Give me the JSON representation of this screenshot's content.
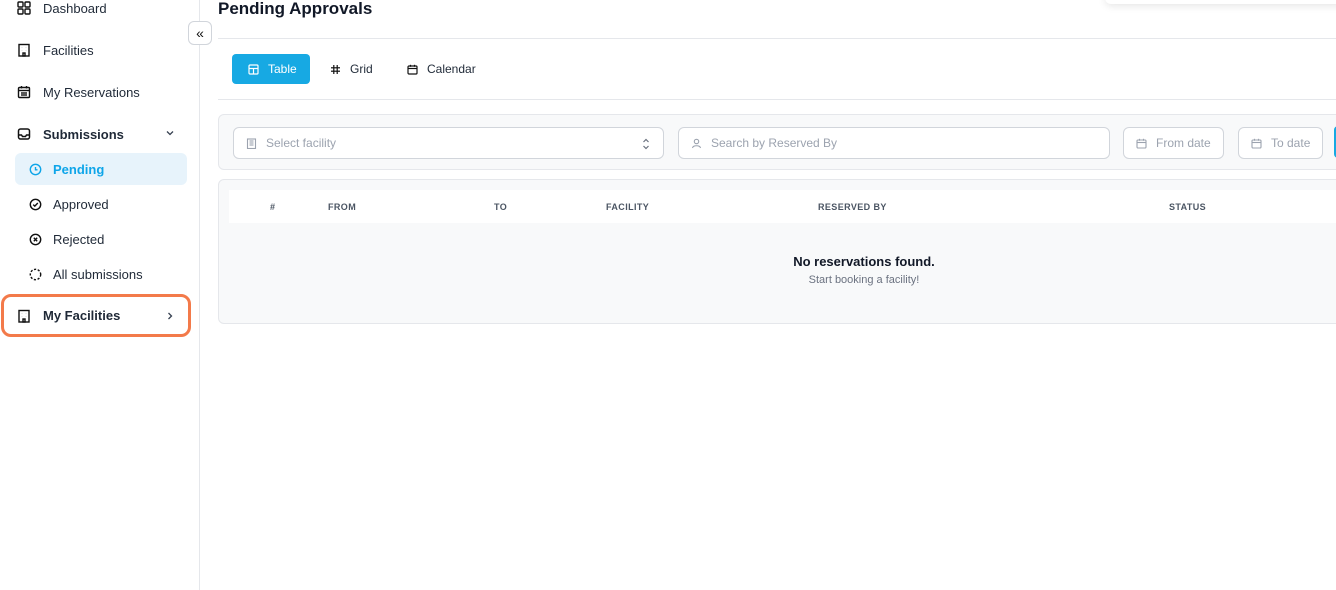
{
  "sidebar": {
    "nav": [
      {
        "label": "Dashboard",
        "icon": "dashboard-icon"
      },
      {
        "label": "Facilities",
        "icon": "building-icon"
      },
      {
        "label": "My Reservations",
        "icon": "calendar-icon"
      },
      {
        "label": "Submissions",
        "icon": "inbox-icon"
      }
    ],
    "submissions_items": [
      {
        "label": "Pending",
        "icon": "clock-icon",
        "active": true
      },
      {
        "label": "Approved",
        "icon": "check-circle-icon"
      },
      {
        "label": "Rejected",
        "icon": "x-circle-icon"
      },
      {
        "label": "All submissions",
        "icon": "dashed-circle-icon"
      }
    ],
    "my_facilities": {
      "label": "My Facilities",
      "icon": "building-icon",
      "highlighted": true
    },
    "collapse_glyph": "«"
  },
  "main": {
    "title": "Pending Approvals",
    "view_tabs": [
      {
        "label": "Table",
        "icon": "table-icon",
        "active": true
      },
      {
        "label": "Grid",
        "icon": "grid-icon"
      },
      {
        "label": "Calendar",
        "icon": "calendar-icon"
      }
    ],
    "filters": {
      "facility_placeholder": "Select facility",
      "search_placeholder": "Search by Reserved By",
      "from_date_placeholder": "From date",
      "to_date_placeholder": "To date"
    },
    "table": {
      "columns": [
        "#",
        "FROM",
        "TO",
        "FACILITY",
        "RESERVED BY",
        "STATUS"
      ],
      "empty_title": "No reservations found.",
      "empty_subtitle": "Start booking a facility!"
    }
  },
  "colors": {
    "accent": "#17a9e3",
    "active_bg": "#e7f3fb",
    "highlight_border": "#f37a4a"
  }
}
